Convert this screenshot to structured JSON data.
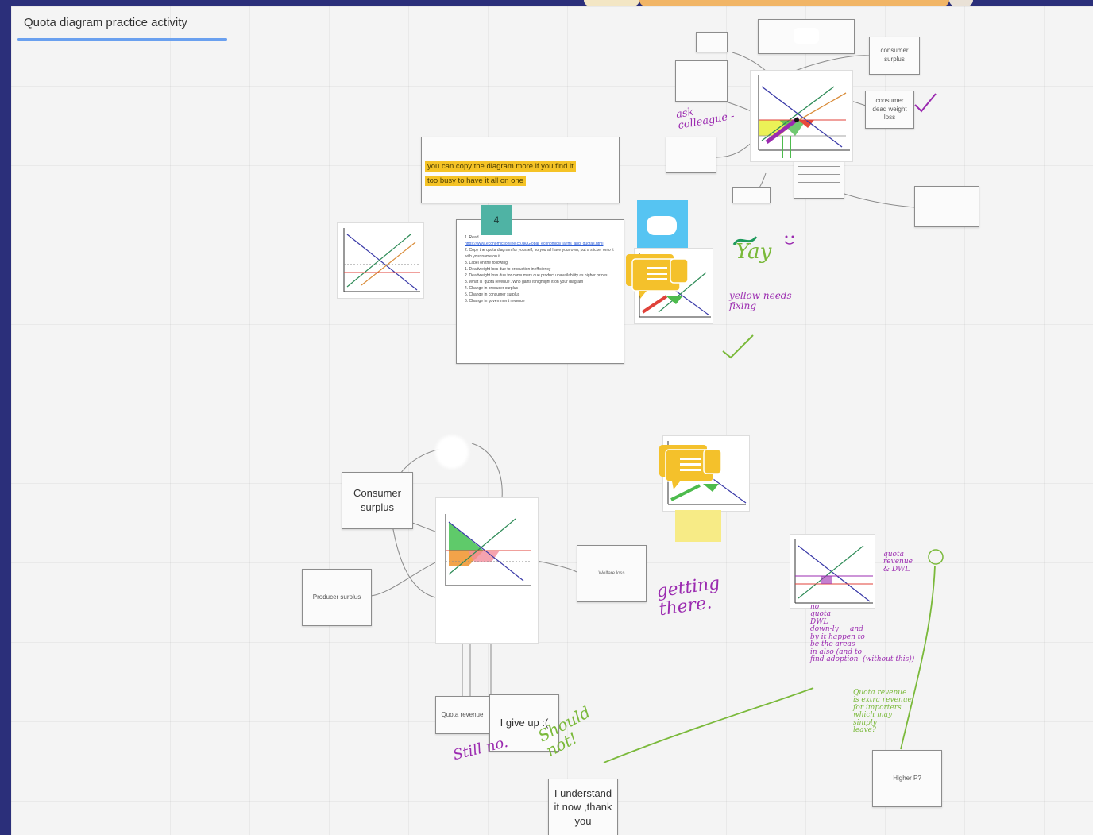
{
  "board_title": "Quota diagram practice activity",
  "highlight_note": {
    "line1": "you can copy the diagram more if you find it",
    "line2": "too busy to have it all on one"
  },
  "instructions": {
    "tag": "4",
    "lines": [
      "1. Read",
      "https://www.economicsonline.co.uk/Global_economics/Tariffs_and_quotas.html",
      "",
      "2. Copy the quota diagram for yourself, so you all have your own, put a sticker onto it with your name on it",
      "",
      "3. Label on the following:",
      "1.     Deadweight loss due to production inefficiency",
      "2.     Deadweight loss due for consumers due product unavailability as higher prices",
      "3.     What is 'quota revenue'. Who gains it highlight it on your diagram",
      "4.     Change in producer surplus",
      "5.     Change in consumer surplus",
      "6.     Change in government revenue"
    ]
  },
  "top_right_labels": {
    "consumer_surplus": "consumer surplus",
    "consumer_dwl": "consumer dead weight loss"
  },
  "bottom_labels": {
    "consumer_surplus": "Consumer surplus",
    "producer_surplus": "Producer surplus",
    "quota_revenue": "Quota revenue",
    "give_up": "I give up :(",
    "understand": "I understand it now ,thank you",
    "welfare_loss": "Welfare loss"
  },
  "handwriting": {
    "ask_colleague": "ask\ncolleague -",
    "yay": "Yay",
    "yellow_needs_fixing": "yellow needs\nfixing",
    "getting_there": "getting\nthere.",
    "still_no": "Still no.",
    "should_not": "Should\nnot!",
    "quota_revenue_note": "quota\nrevenue\n& DWL",
    "purple_notes": "no\nquota\nDWL\ndown-ly     and\nby it happen to\nbe the areas\nin also (and to\nfind adoption  (without this))",
    "green_notes": "Quota revenue\nis extra revenue\nfor importers\nwhich may\nsimply\nleave?",
    "higher_p": "Higher P?"
  },
  "colors": {
    "frame": "#2b2f7a",
    "board": "#f4f4f4",
    "highlight": "#f5c326",
    "handwriting_purple": "#9b2bb0",
    "handwriting_green": "#7ab93a",
    "handwriting_teal": "#1e9a5c",
    "comment_yellow": "#f4c12b",
    "sticky_blue": "#56c4f2"
  },
  "icons": [
    "comment-stack-icon",
    "checkmark-icon",
    "smiley-icon"
  ]
}
